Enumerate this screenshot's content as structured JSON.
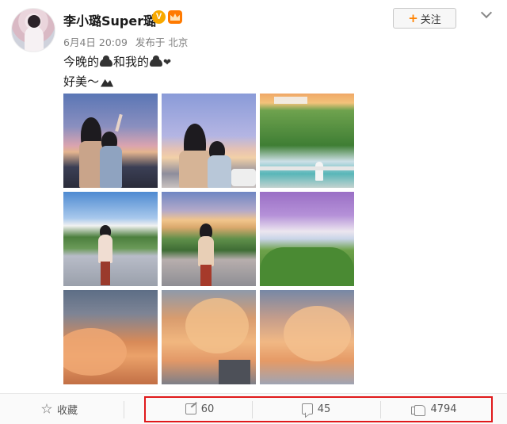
{
  "user": {
    "name": "李小璐Super璐",
    "verified_badge": "V"
  },
  "post_meta": {
    "date": "6月4日 20:09",
    "source": "发布于 北京"
  },
  "follow": {
    "plus": "+",
    "label": "关注"
  },
  "content": {
    "line1_part1": "今晚的",
    "line1_part2": "和我的",
    "line1_part3": "❤",
    "line2": "好美～"
  },
  "images": [
    {
      "icon": "photo-two-girls-sunset"
    },
    {
      "icon": "photo-two-girls-clouds"
    },
    {
      "icon": "photo-park-willows"
    },
    {
      "icon": "photo-plaza-clouds"
    },
    {
      "icon": "photo-girl-plaza"
    },
    {
      "icon": "photo-clouds-trees"
    },
    {
      "icon": "photo-orange-clouds"
    },
    {
      "icon": "photo-clouds-building"
    },
    {
      "icon": "photo-sunset-clouds"
    }
  ],
  "actions": {
    "favorite_label": "收藏",
    "share_count": "60",
    "comment_count": "45",
    "like_count": "4794"
  },
  "colors": {
    "accent_orange": "#ff8200",
    "highlight_red": "#e0191b",
    "verified_gold": "#f8a900"
  }
}
